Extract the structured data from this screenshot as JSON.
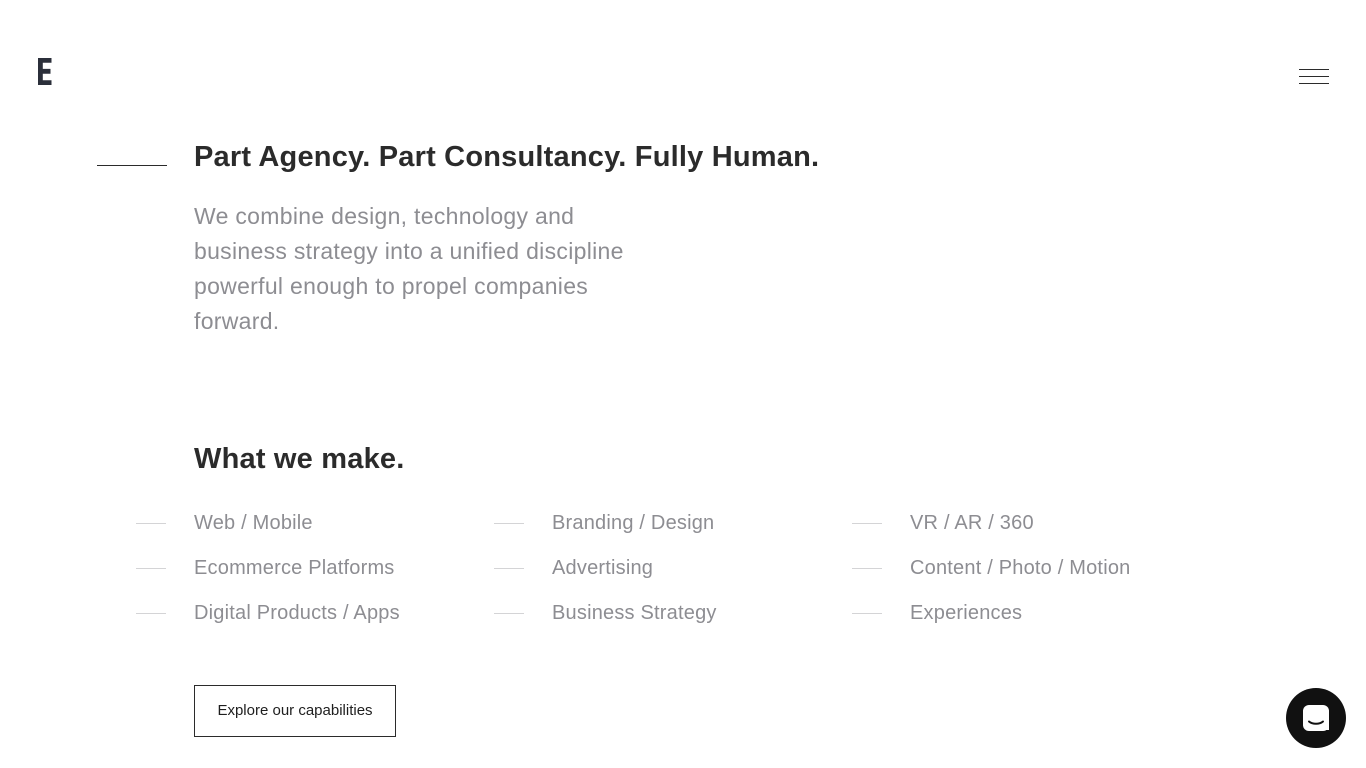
{
  "header": {
    "logo_letter": "E",
    "menu_icon": "hamburger-menu-icon"
  },
  "hero": {
    "title": "Part Agency. Part Consultancy. Fully Human.",
    "description": "We combine design, technology and business strategy into a unified discipline powerful enough to propel companies forward."
  },
  "capabilities": {
    "title": "What we make.",
    "columns": [
      {
        "items": [
          "Web / Mobile",
          "Ecommerce Platforms",
          "Digital Products / Apps"
        ]
      },
      {
        "items": [
          "Branding / Design",
          "Advertising",
          "Business Strategy"
        ]
      },
      {
        "items": [
          "VR / AR / 360",
          "Content / Photo / Motion",
          "Experiences"
        ]
      }
    ],
    "cta_label": "Explore our capabilities"
  },
  "chat": {
    "icon": "chat-bubble-icon"
  },
  "colors": {
    "text_dark": "#2b2b2b",
    "text_muted": "#8d8d92",
    "rule_light": "#d4d4d6",
    "chat_bg": "#111111",
    "background": "#ffffff"
  }
}
